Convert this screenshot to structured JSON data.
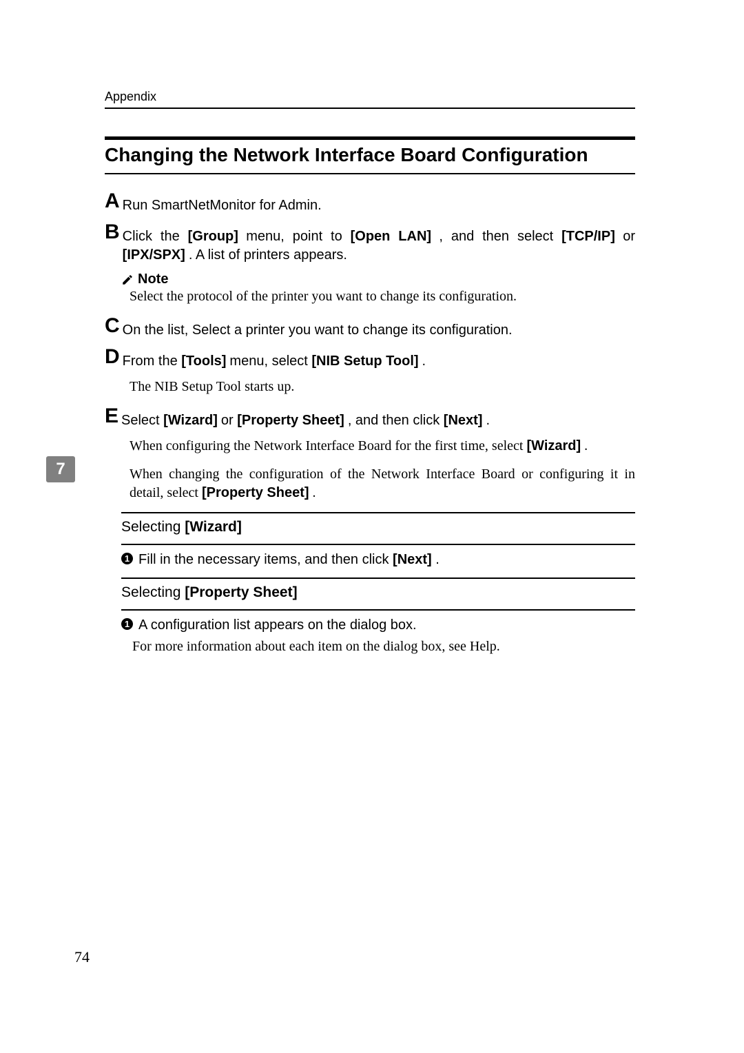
{
  "header": {
    "running": "Appendix"
  },
  "title": "Changing the Network Interface Board Configuration",
  "steps": {
    "A": {
      "letter": "A",
      "text": "Run SmartNetMonitor for Admin."
    },
    "B": {
      "letter": "B",
      "t1": "Click the ",
      "b1": "[Group]",
      "t2": " menu, point to ",
      "b2": "[Open LAN]",
      "t3": ", and then select ",
      "b3": "[TCP/IP]",
      "t4": " or ",
      "b4": "[IPX/SPX]",
      "t5": ". A list of printers appears."
    },
    "C": {
      "letter": "C",
      "text": "On the list, Select a printer you want to change its configuration."
    },
    "D": {
      "letter": "D",
      "t1": "From the ",
      "b1": "[Tools]",
      "t2": " menu, select ",
      "b2": "[NIB Setup Tool]",
      "t3": ".",
      "follow": "The NIB Setup Tool starts up."
    },
    "E": {
      "letter": "E",
      "t1": "Select ",
      "b1": "[Wizard]",
      "t2": " or ",
      "b2": "[Property Sheet]",
      "t3": ", and then click ",
      "b3": "[Next]",
      "t4": ".",
      "f1a": "When configuring the Network Interface Board for the first time, select ",
      "f1b": "[Wizard]",
      "f1c": ".",
      "f2a": "When changing the configuration of the Network Interface Board or configuring it in detail, select ",
      "f2b": "[Property Sheet]",
      "f2c": "."
    }
  },
  "note": {
    "label": "Note",
    "body": "Select the protocol of the printer you want to change its configuration."
  },
  "wizard": {
    "head_a": "Selecting ",
    "head_b": "[Wizard]",
    "bullet_num": "1",
    "bullet_t1": "Fill in the necessary items, and then click ",
    "bullet_b1": "[Next]",
    "bullet_t2": "."
  },
  "propsheet": {
    "head_a": "Selecting ",
    "head_b": "[Property Sheet]",
    "bullet_num": "1",
    "bullet_t1": "A configuration list appears on the dialog box.",
    "follow": "For more information about each item on the dialog box, see Help."
  },
  "chapter_tab": "7",
  "page_number": "74"
}
